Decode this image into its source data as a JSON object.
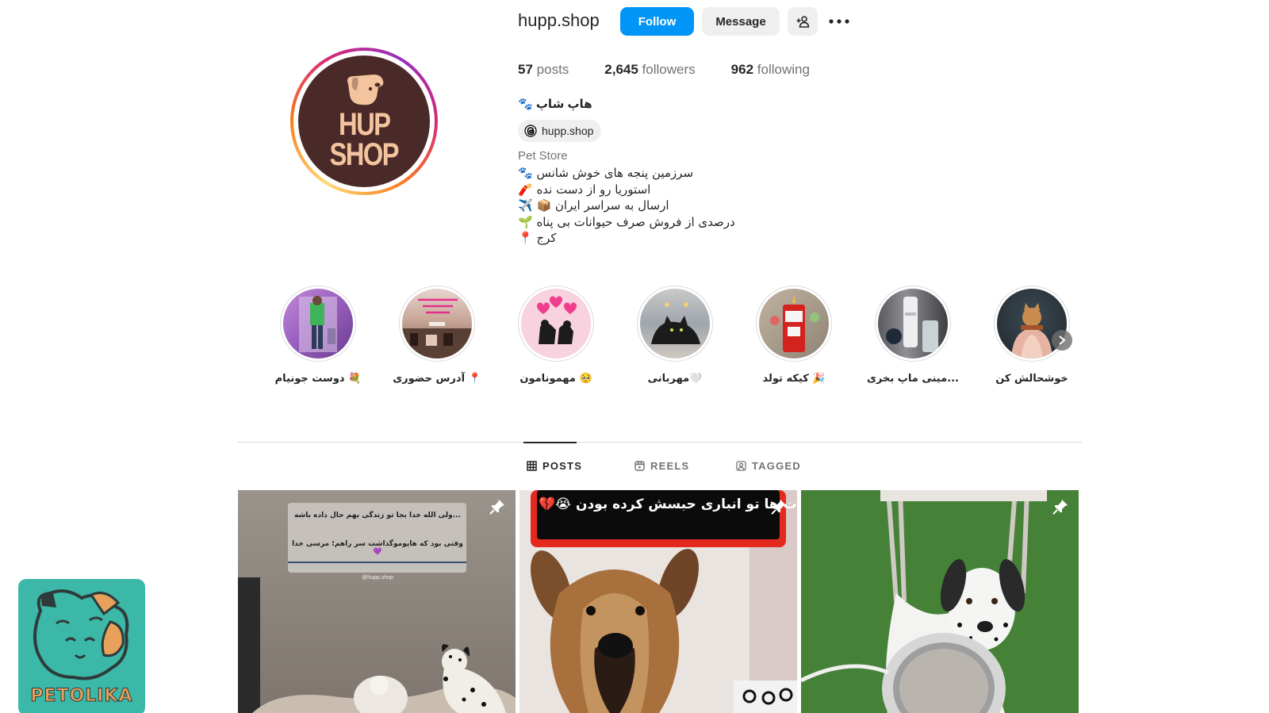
{
  "profile": {
    "username": "hupp.shop",
    "follow_label": "Follow",
    "message_label": "Message",
    "avatar_logo_line1": "HUP",
    "avatar_logo_line2": "SHOP",
    "stats": {
      "posts_count": "57",
      "posts_label": "posts",
      "followers_count": "2,645",
      "followers_label": "followers",
      "following_count": "962",
      "following_label": "following"
    },
    "full_name": "🐾 هاپ شاپ",
    "threads_handle": "hupp.shop",
    "category": "Pet Store",
    "bio_lines": [
      "🐾 سرزمین پنجه های خوش شانس",
      "🧨 استوریا رو از دست نده",
      "✈️ 📦 ارسال به سراسر ایران",
      "🌱 درصدی از فروش صرف حیوانات بی پناه",
      "📍 کرج"
    ]
  },
  "highlights": [
    {
      "label": "دوست جونیام 💐",
      "icon": "friends-highlight"
    },
    {
      "label": "آدرس حضوری 📍",
      "icon": "address-highlight"
    },
    {
      "label": "مهمونامون 🥺",
      "icon": "guests-highlight"
    },
    {
      "label": "مهربانی🤍",
      "icon": "kindness-highlight"
    },
    {
      "label": "کیکه تولد 🎉",
      "icon": "birthday-cake-highlight"
    },
    {
      "label": "مینی ماپ بخری...",
      "icon": "mini-mop-highlight"
    },
    {
      "label": "خوشحالش کن",
      "icon": "make-happy-highlight"
    }
  ],
  "tabs": [
    {
      "label": "POSTS",
      "icon": "grid-icon",
      "active": true
    },
    {
      "label": "REELS",
      "icon": "reels-icon",
      "active": false
    },
    {
      "label": "TAGGED",
      "icon": "tagged-icon",
      "active": false
    }
  ],
  "posts": [
    {
      "overlay_text_1": "ولی الله خدا بجا تو زندگی بهم حال داده باشه...",
      "overlay_text_2": "وقتی بود که هاپوموگذاشت سر راهم؛ مرسی خدا 💜",
      "overlay_handle": "@hupp.shop",
      "pinned": true
    },
    {
      "caption": "💔😭 مدت ها تو انباری حبسش کرده بودن",
      "pinned": true
    },
    {
      "pinned": true
    }
  ],
  "watermark": {
    "text": "PETOLIKA"
  },
  "colors": {
    "follow_blue": "#0095f6",
    "avatar_brown": "#4a2a28",
    "logo_peach": "#f3c49e",
    "watermark_teal": "#3cb8a8"
  }
}
